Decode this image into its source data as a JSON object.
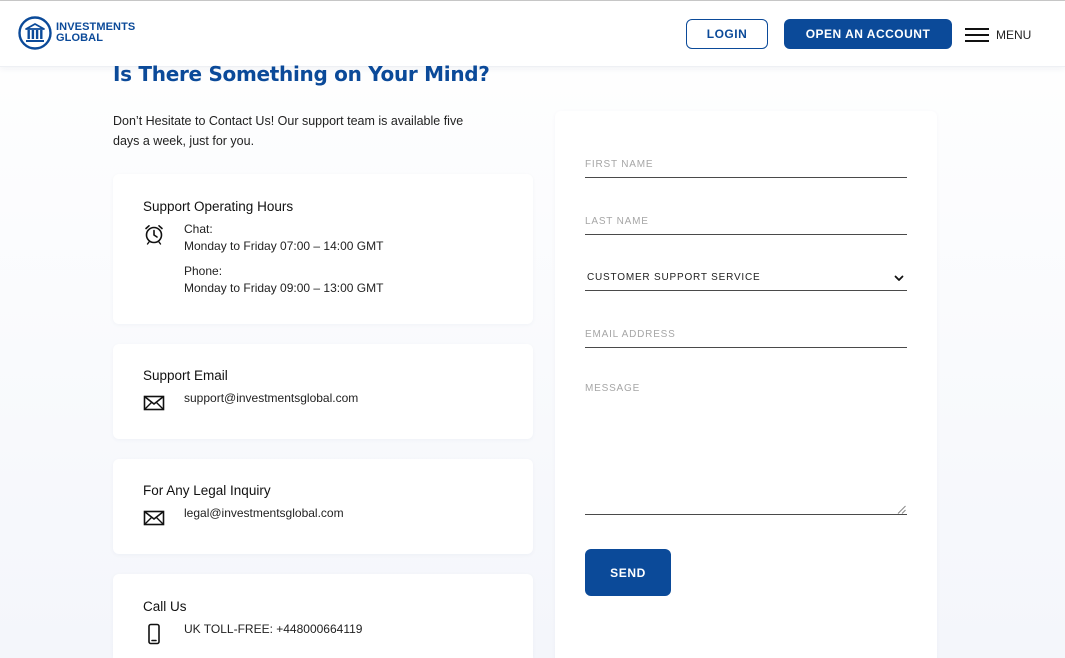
{
  "header": {
    "logo_line1": "INVESTMENTS",
    "logo_line2": "GLOBAL",
    "login_label": "LOGIN",
    "open_account_label": "OPEN AN ACCOUNT",
    "menu_label": "MENU"
  },
  "main": {
    "title": "Is There Something on Your Mind?",
    "intro": "Don’t Hesitate to Contact Us! Our support team is available five days a week, just for you."
  },
  "cards": {
    "hours": {
      "title": "Support Operating Hours",
      "chat_label": "Chat:",
      "chat_hours": "Monday to Friday 07:00 – 14:00 GMT",
      "phone_label": "Phone:",
      "phone_hours": "Monday to Friday 09:00 – 13:00 GMT",
      "icon": "alarm-clock-icon"
    },
    "email": {
      "title": "Support Email",
      "value": "support@investmentsglobal.com",
      "icon": "envelope-icon"
    },
    "legal": {
      "title": "For Any Legal Inquiry",
      "value": "legal@investmentsglobal.com",
      "icon": "envelope-icon"
    },
    "call": {
      "title": "Call Us",
      "value": "UK TOLL-FREE: +448000664119",
      "icon": "mobile-phone-icon"
    }
  },
  "form": {
    "first_name_placeholder": "FIRST NAME",
    "first_name_value": "",
    "last_name_placeholder": "LAST NAME",
    "last_name_value": "",
    "department_selected": "CUSTOMER SUPPORT SERVICE",
    "email_placeholder": "EMAIL ADDRESS",
    "email_value": "",
    "message_placeholder": "MESSAGE",
    "message_value": "",
    "send_label": "SEND"
  },
  "colors": {
    "brand": "#0b4a99",
    "background": "#f4f6fb",
    "card": "#ffffff"
  }
}
